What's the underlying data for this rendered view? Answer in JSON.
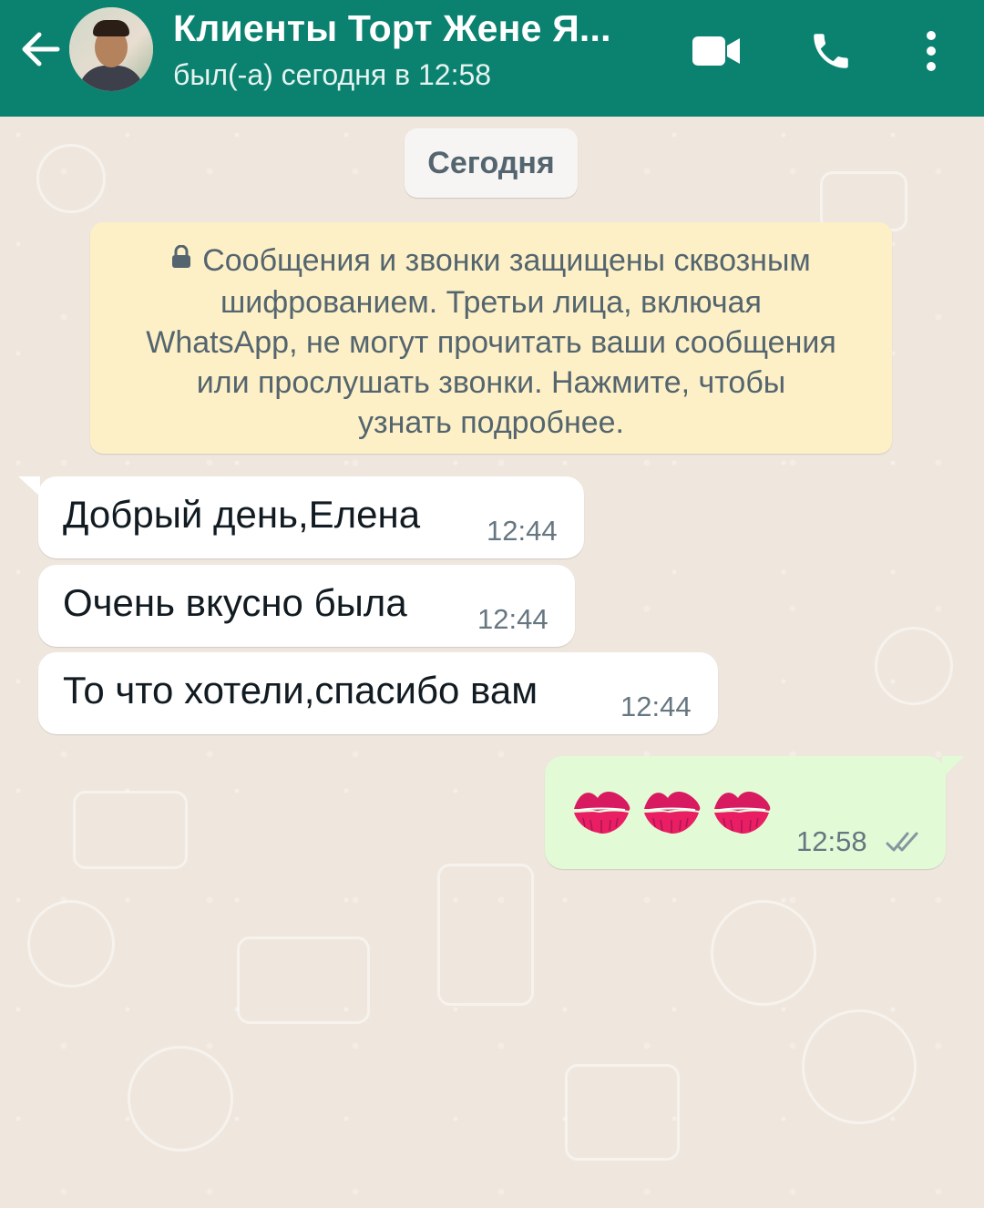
{
  "header": {
    "contact_name": "Клиенты Торт Жене Я...",
    "status": "был(-а) сегодня в 12:58",
    "icons": [
      "back-arrow-icon",
      "avatar",
      "video-call-icon",
      "phone-icon",
      "more-options-icon"
    ]
  },
  "chat": {
    "date_label": "Сегодня",
    "encryption_notice": {
      "lines": [
        "Сообщения и звонки защищены сквозным",
        "шифрованием. Третьи лица, включая",
        "WhatsApp, не могут прочитать ваши сообщения",
        "или прослушать звонки. Нажмите, чтобы",
        "узнать подробнее."
      ]
    },
    "messages": [
      {
        "direction": "in",
        "text": "Добрый день,Елена",
        "time": "12:44"
      },
      {
        "direction": "in",
        "text": "Очень вкусно была",
        "time": "12:44"
      },
      {
        "direction": "in",
        "text": "То что хотели,спасибо вам",
        "time": "12:44"
      },
      {
        "direction": "out",
        "emoji": [
          "kiss-mark",
          "kiss-mark",
          "kiss-mark"
        ],
        "time": "12:58",
        "status": "read-double-check"
      }
    ]
  },
  "colors": {
    "header": "#0b8270",
    "chat_background": "#efe7de",
    "incoming_bubble": "#ffffff",
    "outgoing_bubble": "#e2fbd6",
    "notice_bubble": "#fdf0c6",
    "lips": "#d81b60"
  }
}
